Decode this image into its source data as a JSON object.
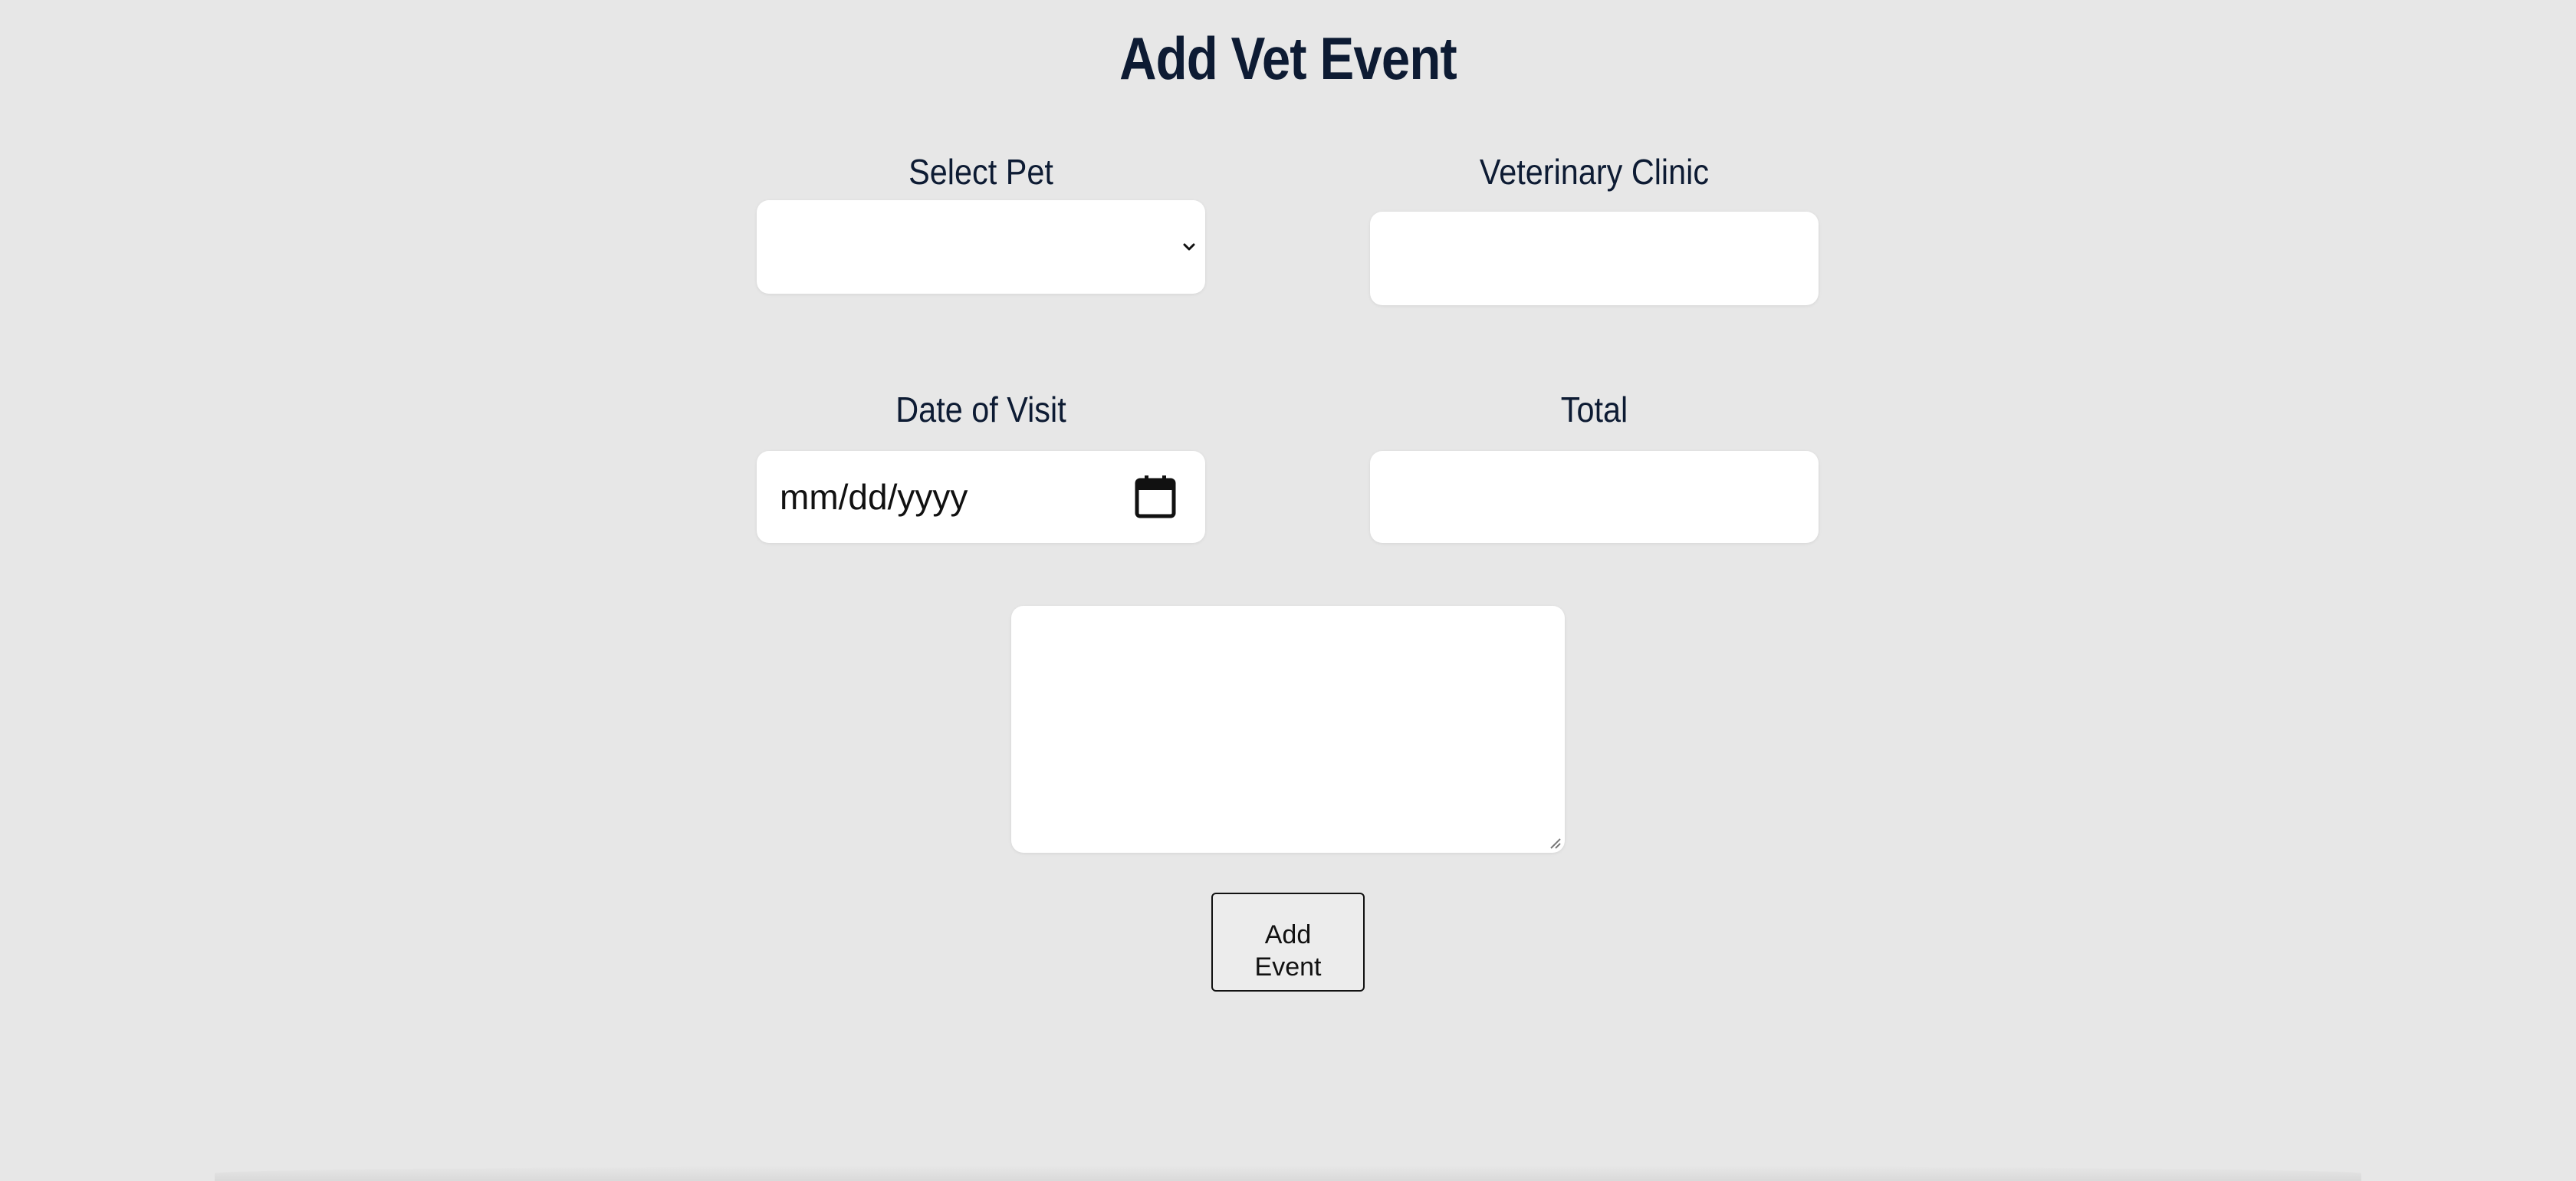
{
  "form": {
    "title": "Add Vet Event",
    "select_pet": {
      "label": "Select Pet",
      "selected_value": ""
    },
    "veterinary_clinic": {
      "label": "Veterinary Clinic",
      "value": ""
    },
    "date_of_visit": {
      "label": "Date of Visit",
      "placeholder": "mm/dd/yyyy",
      "icon": "calendar-icon"
    },
    "total": {
      "label": "Total",
      "value": ""
    },
    "notes": {
      "value": ""
    },
    "submit_label": "Add Event"
  },
  "colors": {
    "background": "#e7e7e7",
    "heading_text": "#0d1b33",
    "field_background": "#ffffff"
  }
}
